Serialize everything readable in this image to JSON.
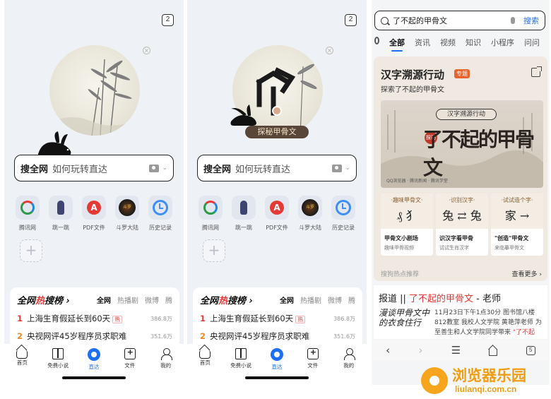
{
  "panel_left": {
    "tab_count": "2",
    "search": {
      "brand": "搜全网",
      "hint": "如何玩转直达"
    },
    "apps": [
      {
        "label": "腾讯网",
        "icon": "tencent-news-icon"
      },
      {
        "label": "跳一跳",
        "icon": "jump-game-icon"
      },
      {
        "label": "PDF文件",
        "icon": "pdf-icon"
      },
      {
        "label": "斗罗大陆",
        "icon": "douluo-icon"
      },
      {
        "label": "历史记录",
        "icon": "history-icon"
      }
    ],
    "add_label": "+",
    "hot": {
      "logo_a": "全网",
      "logo_b": "热",
      "logo_c": "搜榜 ›",
      "tabs": [
        "全网",
        "热播剧",
        "微博",
        "腾"
      ],
      "items": [
        {
          "rank": "1",
          "title": "上海生育假延长到60天",
          "tag": "热",
          "count": "386.8万"
        },
        {
          "rank": "2",
          "title": "央视网评45岁程序员求职难",
          "count": "351.6万"
        }
      ]
    },
    "tabbar": [
      "首页",
      "免费小说",
      "直达",
      "文件",
      "我的"
    ]
  },
  "panel_middle": {
    "tab_count": "2",
    "plaque": "探秘甲骨文",
    "search": {
      "brand": "搜全网",
      "hint": "如何玩转直达"
    },
    "apps": [
      {
        "label": "腾讯网"
      },
      {
        "label": "跳一跳"
      },
      {
        "label": "PDF文件"
      },
      {
        "label": "斗罗大陆"
      },
      {
        "label": "历史记录"
      }
    ],
    "hot": {
      "logo_a": "全网",
      "logo_b": "热",
      "logo_c": "搜榜 ›",
      "tabs": [
        "全网",
        "热播剧",
        "微博",
        "腾"
      ],
      "items": [
        {
          "rank": "1",
          "title": "上海生育假延长到60天",
          "tag": "热",
          "count": "386.8万"
        },
        {
          "rank": "2",
          "title": "央视网评45岁程序员求职难",
          "count": "351.6万"
        }
      ]
    },
    "tabbar": [
      "首页",
      "免费小说",
      "直达",
      "文件",
      "我的"
    ]
  },
  "panel_right": {
    "query": "了不起的甲骨文",
    "search_button": "搜索",
    "tabs": [
      "全部",
      "资讯",
      "视频",
      "知识",
      "小程序",
      "问问"
    ],
    "card": {
      "title": "汉字溯源行动",
      "badge": "专题",
      "subtitle": "探索了不起的甲骨文",
      "banner_tag": "汉字溯源行动",
      "banner_big": "了不起的甲骨文",
      "banner_seal": "探秘",
      "banner_foot": "QQ浏览器 · 腾讯新闻 · 腾讯学堂",
      "minis": [
        {
          "head": "·趣味甲骨文·",
          "glyph": "₰ 犭",
          "title": "甲骨文小剧场",
          "sub": "趣味甲骨视频"
        },
        {
          "head": "·识别汉字·",
          "glyph": "兔 ⇄ 兔",
          "title": "识汉字看甲骨",
          "sub": "试试生肖汉字"
        },
        {
          "head": "·试试造个字·",
          "glyph": "家 →",
          "title": "\"创造\"甲骨文",
          "sub": "来临摹甲骨文"
        }
      ],
      "hot_recommend": "搜狗热点推荐",
      "see_more": "查看更多 ›"
    },
    "result": {
      "title_prefix": "报道 || ",
      "title_hl": "了不起的甲骨文",
      "title_suffix": " - 老师",
      "thumb_text": "漫谈甲骨文中的衣食住行",
      "desc_a": "11月23日下午1点30分 图书馆八楼812教室 我校人文学院 黄艳萍老师 为至善生和人文学院同学带来 ",
      "desc_hl": "\"了不起"
    },
    "navbar": {
      "back": "‹",
      "forward": "›",
      "menu": "☰",
      "tabs": "5"
    }
  },
  "watermark": {
    "name": "浏览器乐园",
    "url": "liulanqi.com.cn"
  }
}
